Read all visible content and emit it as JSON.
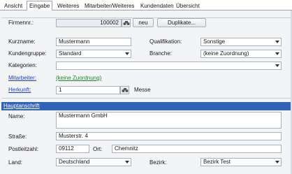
{
  "tabs": [
    {
      "label": "Ansicht",
      "active": false
    },
    {
      "label": "Eingabe",
      "active": true
    },
    {
      "label": "Weiteres",
      "active": false
    },
    {
      "label": "Mitarbeiter/Weiteres",
      "active": false
    },
    {
      "label": "Kundendaten",
      "active": false
    },
    {
      "label": "Übersicht",
      "active": false
    }
  ],
  "form": {
    "firmennr_label": "Firmennr.:",
    "firmennr_value": "100002",
    "neu_label": "neu",
    "duplikate_label": "Duplikate...",
    "kurzname_label": "Kurzname:",
    "kurzname_value": "Mustermann",
    "qualifikation_label": "Qualifikation:",
    "qualifikation_value": "Sonstige",
    "kundengruppe_label": "Kundengruppe:",
    "kundengruppe_value": "Standard",
    "branche_label": "Branche:",
    "branche_value": "(keine Zuordnung)",
    "kategorien_label": "Kategorien:",
    "kategorien_value": "",
    "mitarbeiter_label": "Mitarbeiter:",
    "mitarbeiter_value": "(keine Zuordnung)",
    "herkunft_label": "Herkunft:",
    "herkunft_value": "1",
    "herkunft_suffix": "Messe"
  },
  "address": {
    "section_title": "Hauptanschrift",
    "name_label": "Name:",
    "name_value": "Mustermann GmbH",
    "strasse_label": "Straße:",
    "strasse_value": "Musterstr. 4",
    "plz_label": "Postleitzahl:",
    "plz_value": "09112",
    "ort_label": "Ort:",
    "ort_value": "Chemnitz",
    "land_label": "Land:",
    "land_value": "Deutschland",
    "bezirk_label": "Bezirk:",
    "bezirk_value": "Bezirk Test"
  },
  "colors": {
    "section_header_bg": "#2f62b8",
    "link_blue": "#1f3fd0",
    "link_green": "#1e8a2a",
    "panel_bg": "#f3f4f6"
  }
}
